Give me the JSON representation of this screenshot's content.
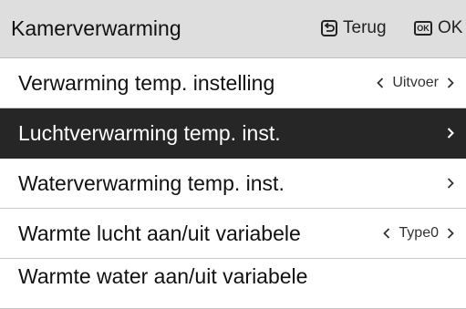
{
  "header": {
    "title": "Kamerverwarming",
    "back_label": "Terug",
    "ok_icon_text": "OK",
    "ok_label": "OK",
    "back_icon": "return-arrow-icon",
    "ok_icon": "ok-key-icon"
  },
  "menu": {
    "items": [
      {
        "label": "Verwarming temp. instelling",
        "value": "Uitvoer",
        "has_left_arrow": true,
        "selected": false
      },
      {
        "label": "Luchtverwarming temp. inst.",
        "value": "",
        "has_left_arrow": false,
        "selected": true
      },
      {
        "label": "Waterverwarming temp. inst.",
        "value": "",
        "has_left_arrow": false,
        "selected": false
      },
      {
        "label": "Warmte lucht aan/uit variabele",
        "value": "Type0",
        "has_left_arrow": true,
        "selected": false
      },
      {
        "label": "Warmte water aan/uit variabele",
        "value": "",
        "has_left_arrow": false,
        "selected": false
      }
    ]
  },
  "colors": {
    "header_bg": "#dedede",
    "selected_bg": "#262626",
    "divider": "#c6c6c6"
  }
}
